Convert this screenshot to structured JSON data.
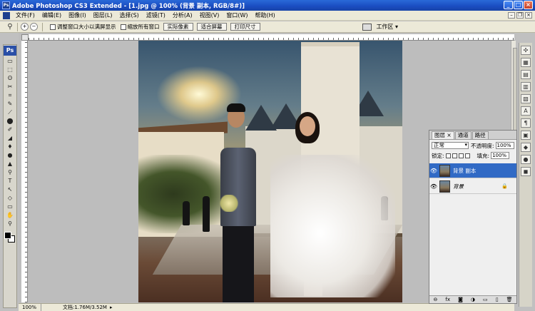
{
  "window": {
    "title": "Adobe Photoshop CS3 Extended - [1.jpg @ 100% (背景 副本, RGB/8#)]",
    "app_icon": "Ps",
    "controls": [
      "_",
      "□",
      "×"
    ]
  },
  "menu": {
    "items": [
      "文件(F)",
      "编辑(E)",
      "图像(I)",
      "图层(L)",
      "选择(S)",
      "滤镜(T)",
      "分析(A)",
      "视图(V)",
      "窗口(W)",
      "帮助(H)"
    ],
    "mdi_controls": [
      "–",
      "❐",
      "×"
    ]
  },
  "options": {
    "tool_icon": "zoom-icon",
    "checkbox_resize": "调整窗口大小以满屏显示",
    "checkbox_zoom_all": "缩放所有窗口",
    "btn_actual": "实际像素",
    "btn_fit": "适合屏幕",
    "btn_print": "打印尺寸",
    "workspace_label": "工作区 ▾"
  },
  "toolbox": {
    "logo": "Ps",
    "tools": [
      "▭",
      "⬚",
      "ʘ",
      "✂",
      "⌗",
      "✎",
      "⟋",
      "⬤",
      "✐",
      "◢",
      "♦",
      "●",
      "▲",
      "⚲",
      "T",
      "↖",
      "◇",
      "▭",
      "✋",
      "⚲"
    ]
  },
  "status": {
    "zoom": "100%",
    "doc": "文档:1.76M/3.52M",
    "arrow": "▸"
  },
  "layers_panel": {
    "tabs": [
      "图层 ×",
      "通道",
      "路径"
    ],
    "blend_mode": "正常",
    "opacity_label": "不透明度:",
    "opacity_value": "100%",
    "lock_label": "锁定:",
    "fill_label": "填充:",
    "fill_value": "100%",
    "layers": [
      {
        "name": "背景 副本",
        "selected": true
      },
      {
        "name": "背景",
        "selected": false
      }
    ],
    "footer_icons": [
      "⊖",
      "fx",
      "◙",
      "◑",
      "▭",
      "▯",
      "🗑"
    ]
  },
  "dock_icons": [
    "✣",
    "▦",
    "▤",
    "▥",
    "▧",
    "A",
    "¶",
    "▣",
    "◆",
    "●",
    "◼"
  ],
  "colors": {
    "title_bar": "#1a4cc0",
    "menu_bg": "#ece9d8",
    "selected_layer": "#316ac5"
  }
}
